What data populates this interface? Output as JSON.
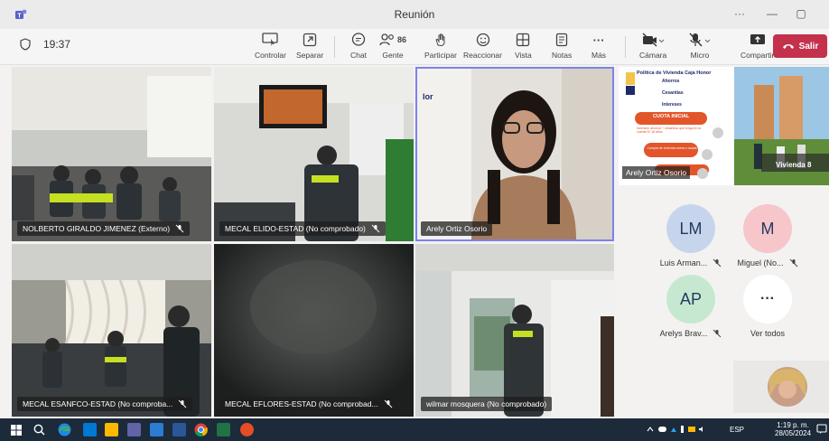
{
  "window": {
    "title": "Reunión",
    "more": "···",
    "minimize": "—",
    "restore": "▢"
  },
  "toolbar": {
    "timer": "19:37",
    "controlar": "Controlar",
    "separar": "Separar",
    "chat": "Chat",
    "gente": "Gente",
    "gente_count": "86",
    "participar": "Participar",
    "reaccionar": "Reaccionar",
    "vista": "Vista",
    "notas": "Notas",
    "mas_label": "Más",
    "mas_icon": "···",
    "camara": "Cámara",
    "micro": "Micro",
    "compartir": "Compartir",
    "salir": "Salir"
  },
  "tiles": [
    {
      "name": "NOLBERTO GIRALDO JIMENEZ (Externo)"
    },
    {
      "name": "MECAL ELIDO-ESTAD (No comprobado)"
    },
    {
      "name": "Arely Ortiz Osorio"
    },
    {
      "name": "MECAL ESANFCO-ESTAD (No comproba..."
    },
    {
      "name": "MECAL EFLORES-ESTAD (No comprobad..."
    },
    {
      "name": "wilmar mosquera (No comprobado)"
    }
  ],
  "shared": {
    "presenter": "Arely Ortiz Osorio",
    "slide_title": "Política de Vivienda Caja Honor",
    "items": [
      "Ahorros",
      "Cesantías",
      "Intereses"
    ],
    "cuota": "CUOTA INICIAL",
    "box1": "Inversión ahorros + cesantías que tenga en la cuenta Nº 18 años",
    "box2": "Compra de vivienda nueva o usada",
    "banner": "Vivienda 8"
  },
  "people": [
    {
      "initials": "LM",
      "name": "Luis Arman...",
      "color": "#c7d5ec"
    },
    {
      "initials": "M",
      "name": "Miguel (No...",
      "color": "#f6c6cb"
    },
    {
      "initials": "AP",
      "name": "Arelys Brav...",
      "color": "#c6e8d1"
    }
  ],
  "see_all": {
    "icon": "···",
    "label": "Ver todos"
  },
  "taskbar": {
    "lang": "ESP",
    "time": "1:19 p. m.",
    "date": "28/05/2024",
    "app_colors": [
      "#0078d4",
      "#6264a7",
      "#f25022",
      "#2b7cd3",
      "#ffb900",
      "#e44d26"
    ]
  }
}
